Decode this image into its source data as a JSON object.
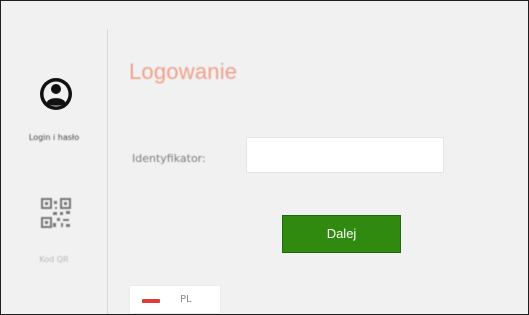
{
  "sidebar": {
    "items": [
      {
        "label": "Login i hasło",
        "icon": "user-circle-icon"
      },
      {
        "label": "Kod QR",
        "icon": "qr-code-icon"
      }
    ]
  },
  "main": {
    "title": "Logowanie",
    "identifier_label": "Identyfikator:",
    "identifier_value": "",
    "next_button": "Dalej"
  },
  "language": {
    "code": "PL",
    "flag_colors": [
      "#ffffff",
      "#df3b3b"
    ]
  },
  "colors": {
    "title": "#f0a08c",
    "button": "#2f8a0f",
    "background": "#f1f1f1"
  }
}
